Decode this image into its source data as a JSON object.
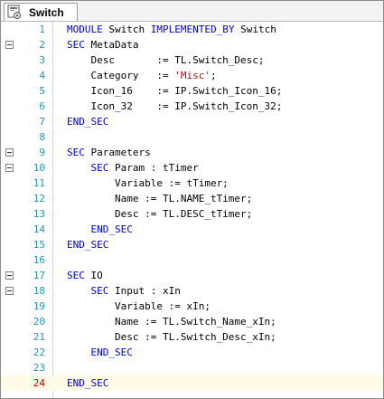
{
  "tab": {
    "label": "Switch",
    "icon": "module-file-icon"
  },
  "current_line": 24,
  "lines": [
    {
      "n": "1",
      "fold": false,
      "tokens": [
        [
          "MODULE",
          "kw"
        ],
        [
          " Switch ",
          ""
        ],
        [
          "IMPLEMENTED_BY",
          "kw"
        ],
        [
          " Switch",
          ""
        ]
      ]
    },
    {
      "n": "2",
      "fold": true,
      "tokens": [
        [
          "SEC",
          "kw"
        ],
        [
          " MetaData",
          ""
        ]
      ]
    },
    {
      "n": "3",
      "fold": false,
      "tokens": [
        [
          "    Desc       := TL.Switch_Desc;",
          ""
        ]
      ]
    },
    {
      "n": "4",
      "fold": false,
      "tokens": [
        [
          "    Category   := ",
          ""
        ],
        [
          "'Misc'",
          "str"
        ],
        [
          ";",
          ""
        ]
      ]
    },
    {
      "n": "5",
      "fold": false,
      "tokens": [
        [
          "    Icon_16    := IP.Switch_Icon_16;",
          ""
        ]
      ]
    },
    {
      "n": "6",
      "fold": false,
      "tokens": [
        [
          "    Icon_32    := IP.Switch_Icon_32;",
          ""
        ]
      ]
    },
    {
      "n": "7",
      "fold": false,
      "tokens": [
        [
          "END_SEC",
          "kw"
        ]
      ]
    },
    {
      "n": "8",
      "fold": false,
      "tokens": []
    },
    {
      "n": "9",
      "fold": true,
      "tokens": [
        [
          "SEC",
          "kw"
        ],
        [
          " Parameters",
          ""
        ]
      ]
    },
    {
      "n": "10",
      "fold": true,
      "tokens": [
        [
          "    ",
          ""
        ],
        [
          "SEC",
          "kw"
        ],
        [
          " Param : tTimer",
          ""
        ]
      ]
    },
    {
      "n": "11",
      "fold": false,
      "tokens": [
        [
          "        Variable := tTimer;",
          ""
        ]
      ]
    },
    {
      "n": "12",
      "fold": false,
      "tokens": [
        [
          "        Name := TL.NAME_tTimer;",
          ""
        ]
      ]
    },
    {
      "n": "13",
      "fold": false,
      "tokens": [
        [
          "        Desc := TL.DESC_tTimer;",
          ""
        ]
      ]
    },
    {
      "n": "14",
      "fold": false,
      "tokens": [
        [
          "    ",
          ""
        ],
        [
          "END_SEC",
          "kw"
        ]
      ]
    },
    {
      "n": "15",
      "fold": false,
      "tokens": [
        [
          "END_SEC",
          "kw"
        ]
      ]
    },
    {
      "n": "16",
      "fold": false,
      "tokens": []
    },
    {
      "n": "17",
      "fold": true,
      "tokens": [
        [
          "SEC",
          "kw"
        ],
        [
          " IO",
          ""
        ]
      ]
    },
    {
      "n": "18",
      "fold": true,
      "tokens": [
        [
          "    ",
          ""
        ],
        [
          "SEC",
          "kw"
        ],
        [
          " Input : xIn",
          ""
        ]
      ]
    },
    {
      "n": "19",
      "fold": false,
      "tokens": [
        [
          "        Variable := xIn;",
          ""
        ]
      ]
    },
    {
      "n": "20",
      "fold": false,
      "tokens": [
        [
          "        Name := TL.Switch_Name_xIn;",
          ""
        ]
      ]
    },
    {
      "n": "21",
      "fold": false,
      "tokens": [
        [
          "        Desc := TL.Switch_Desc_xIn;",
          ""
        ]
      ]
    },
    {
      "n": "22",
      "fold": false,
      "tokens": [
        [
          "    ",
          ""
        ],
        [
          "END_SEC",
          "kw"
        ]
      ]
    },
    {
      "n": "23",
      "fold": false,
      "tokens": []
    },
    {
      "n": "24",
      "fold": false,
      "tokens": [
        [
          "END_SEC",
          "kw"
        ]
      ]
    }
  ]
}
